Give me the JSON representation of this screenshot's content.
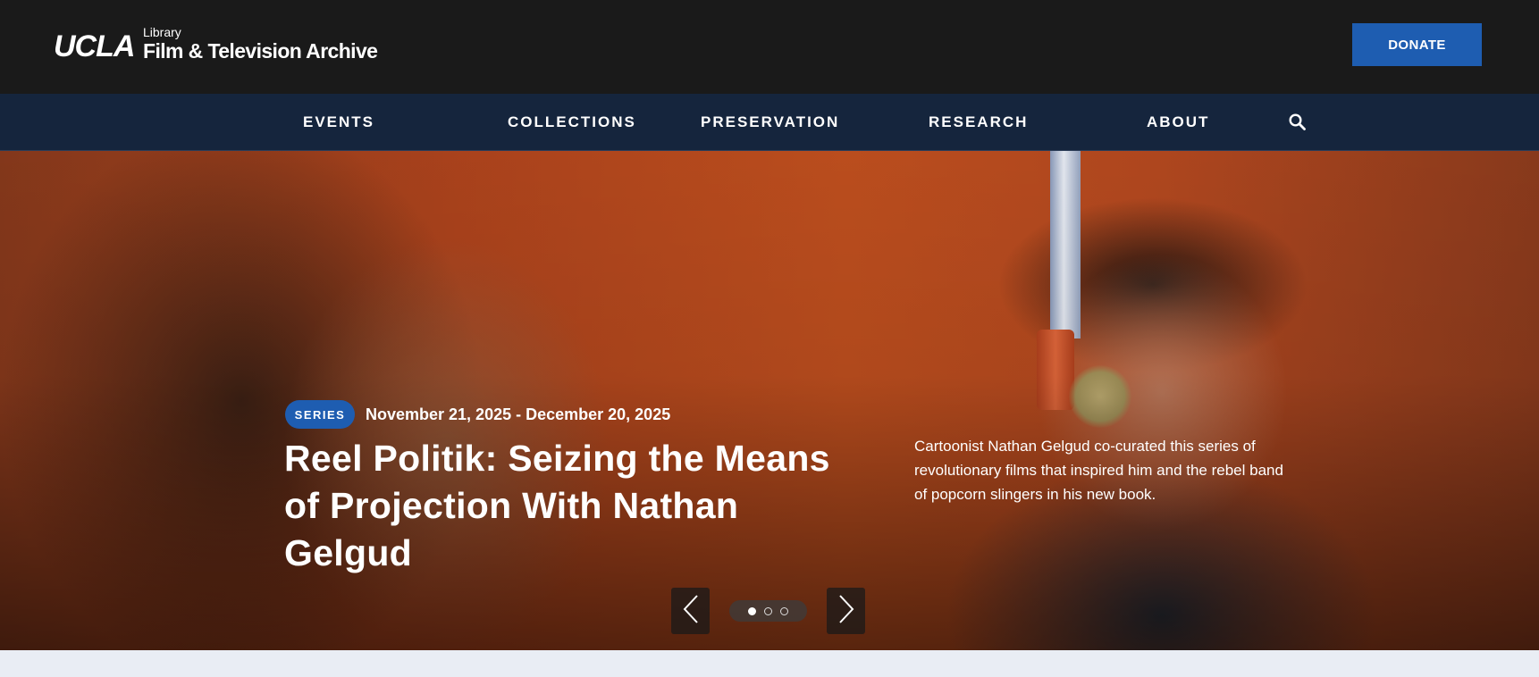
{
  "header": {
    "logo": {
      "ucla": "UCLA",
      "library": "Library",
      "name": "Film & Television Archive"
    },
    "donate_label": "DONATE"
  },
  "nav": {
    "items": [
      {
        "label": "EVENTS"
      },
      {
        "label": "COLLECTIONS"
      },
      {
        "label": "PRESERVATION"
      },
      {
        "label": "RESEARCH"
      },
      {
        "label": "ABOUT"
      }
    ],
    "search_icon": "search-icon"
  },
  "hero": {
    "badge": "SERIES",
    "dates": "November 21, 2025 - December 20, 2025",
    "title": "Reel Politik: Seizing the Means of Projection With Nathan Gelgud",
    "description": "Cartoonist Nathan Gelgud co-curated this series of revolutionary films that inspired him and the rebel band of popcorn slingers in his new book.",
    "carousel": {
      "slide_count": 3,
      "active_slide": 1,
      "prev_icon": "chevron-left-icon",
      "next_icon": "chevron-right-icon"
    }
  },
  "colors": {
    "header_bg": "#1a1a1a",
    "nav_bg": "#15253d",
    "accent_blue": "#1e5db1",
    "page_bg": "#e9edf4"
  }
}
